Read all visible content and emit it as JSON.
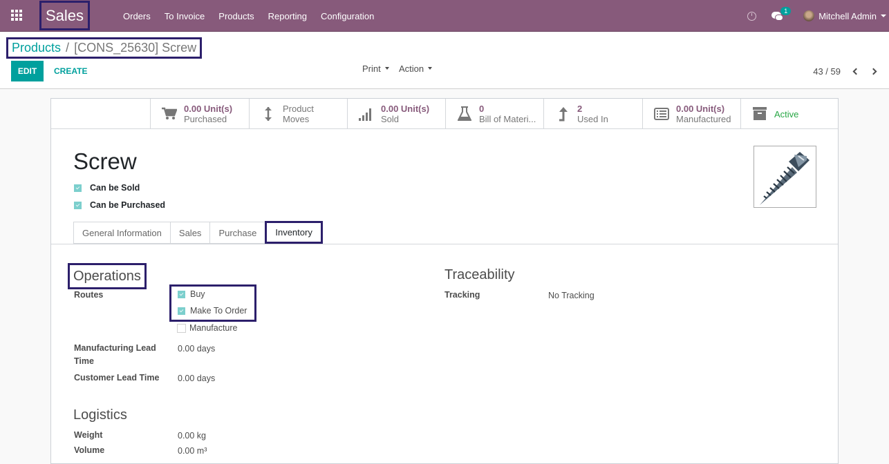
{
  "navbar": {
    "app_name": "Sales",
    "menu": [
      "Orders",
      "To Invoice",
      "Products",
      "Reporting",
      "Configuration"
    ],
    "chat_badge": "1",
    "user_name": "Mitchell Admin",
    "icons": {
      "apps": "apps-grid-icon",
      "activity": "clock-icon",
      "messages": "chat-bubbles-icon"
    }
  },
  "breadcrumb": {
    "parent": "Products",
    "separator": "/",
    "current": "[CONS_25630] Screw"
  },
  "toolbar": {
    "edit_label": "EDIT",
    "create_label": "CREATE",
    "print_label": "Print",
    "action_label": "Action"
  },
  "pager": {
    "value": "43 / 59"
  },
  "stat_buttons": [
    {
      "icon": "shopping-cart-icon",
      "value": "0.00 Unit(s)",
      "label": "Purchased"
    },
    {
      "icon": "arrows-vertical-icon",
      "value": "",
      "label": "Product Moves",
      "line1": "Product",
      "line2": "Moves"
    },
    {
      "icon": "signal-bars-icon",
      "value": "0.00 Unit(s)",
      "label": "Sold"
    },
    {
      "icon": "flask-icon",
      "value": "0",
      "label": "Bill of Materi..."
    },
    {
      "icon": "level-up-icon",
      "value": "2",
      "label": "Used In"
    },
    {
      "icon": "list-alt-icon",
      "value": "0.00 Unit(s)",
      "label": "Manufactured"
    },
    {
      "icon": "archive-icon",
      "value": "",
      "label": "Active"
    }
  ],
  "product": {
    "name": "Screw",
    "can_be_sold_label": "Can be Sold",
    "can_be_sold": true,
    "can_be_purchased_label": "Can be Purchased",
    "can_be_purchased": true,
    "image": "screw-image"
  },
  "tabs": [
    {
      "label": "General Information",
      "active": false
    },
    {
      "label": "Sales",
      "active": false
    },
    {
      "label": "Purchase",
      "active": false
    },
    {
      "label": "Inventory",
      "active": true
    }
  ],
  "inventory": {
    "operations": {
      "title": "Operations",
      "routes_label": "Routes",
      "routes": [
        {
          "label": "Buy",
          "checked": true
        },
        {
          "label": "Make To Order",
          "checked": true
        },
        {
          "label": "Manufacture",
          "checked": false
        }
      ],
      "manufacturing_lead_time_label_1": "Manufacturing Lead",
      "manufacturing_lead_time_label_2": "Time",
      "manufacturing_lead_time": "0.00 days",
      "customer_lead_time_label": "Customer Lead Time",
      "customer_lead_time": "0.00 days"
    },
    "traceability": {
      "title": "Traceability",
      "tracking_label": "Tracking",
      "tracking": "No Tracking"
    },
    "logistics": {
      "title": "Logistics",
      "weight_label": "Weight",
      "weight": "0.00 kg",
      "volume_label": "Volume",
      "volume": "0.00 m³"
    }
  },
  "colors": {
    "navbar": "#875a7b",
    "primary": "#00a09d",
    "highlight_border": "#2c1f6b",
    "stat_value": "#875a7b",
    "active_green": "#28a745"
  }
}
